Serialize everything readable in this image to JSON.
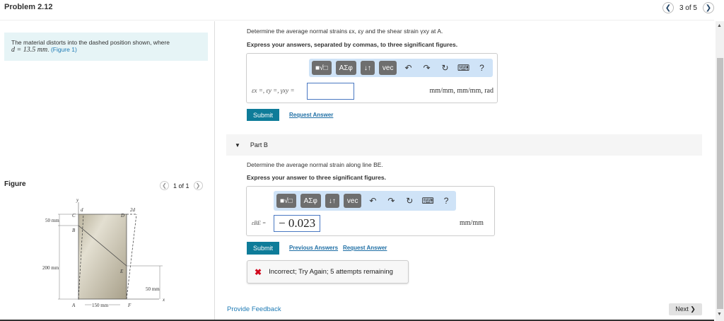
{
  "header": {
    "title": "Problem 2.12",
    "position": "3 of 5"
  },
  "left": {
    "intro": "The material distorts into the dashed position shown, where",
    "intro_math": "d = 13.5 mm",
    "figure_link": "(Figure 1)",
    "figure_label": "Figure",
    "figure_pager": "1 of 1",
    "figure_labels": {
      "y": "y",
      "x": "x",
      "d": "d",
      "2d": "2d",
      "C": "C",
      "D": "D",
      "B": "B",
      "E": "E",
      "A": "A",
      "F": "F",
      "dim1": "50 mm",
      "dim2": "200 mm",
      "dim3": "50 mm",
      "dim4": "150 mm"
    }
  },
  "partA": {
    "question": "Determine the average normal strains εx, εy and the shear strain γxy at A.",
    "instruction": "Express your answers, separated by commas, to three significant figures.",
    "label": "εx =, εy =, γxy =",
    "value": "",
    "units": "mm/mm, mm/mm, rad",
    "submit": "Submit",
    "request": "Request Answer"
  },
  "toolbar": {
    "templates": "■√□",
    "greek": "ΑΣφ",
    "arrows": "↓↑",
    "vec": "vec",
    "undo": "↶",
    "redo": "↷",
    "reset": "↻",
    "keyboard": "⌨",
    "help": "?"
  },
  "partB": {
    "header": "Part B",
    "question": "Determine the average normal strain along line BE.",
    "instruction": "Express your answer to three significant figures.",
    "label": "εBE =",
    "value": "− 0.023",
    "units": "mm/mm",
    "submit": "Submit",
    "previous": "Previous Answers",
    "request": "Request Answer",
    "feedback": "Incorrect; Try Again; 5 attempts remaining"
  },
  "footer": {
    "feedback": "Provide Feedback",
    "next": "Next ❯"
  },
  "colors": {
    "accent": "#0e7c99",
    "info_bg": "#e6f4f6",
    "error": "#d0021b"
  }
}
